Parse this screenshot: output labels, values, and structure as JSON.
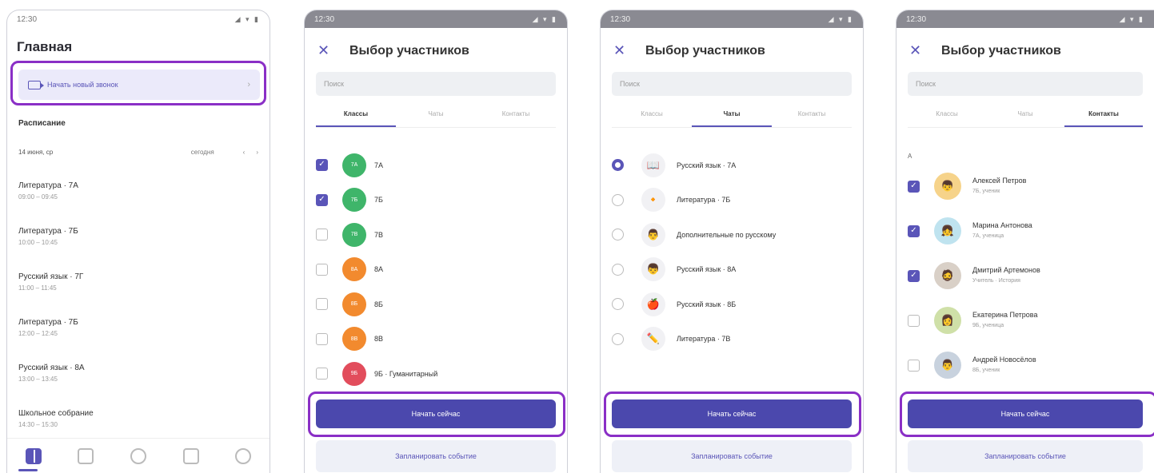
{
  "screen1": {
    "status_time": "12:30",
    "status_icons": "◢ ▾ ▮",
    "title": "Главная",
    "call_button": "Начать новый звонок",
    "schedule_heading": "Расписание",
    "date": "14 июня, ср",
    "today": "сегодня",
    "lessons": [
      {
        "name": "Литература · 7А",
        "time": "09:00 – 09:45"
      },
      {
        "name": "Литература · 7Б",
        "time": "10:00 – 10:45"
      },
      {
        "name": "Русский язык · 7Г",
        "time": "11:00 – 11:45"
      },
      {
        "name": "Литература · 7Б",
        "time": "12:00 – 12:45"
      },
      {
        "name": "Русский язык · 8А",
        "time": "13:00 – 13:45"
      },
      {
        "name": "Школьное собрание",
        "time": "14:30 – 15:30"
      }
    ],
    "tabbar_icons": [
      "home-icon",
      "school-icon",
      "chat-icon",
      "document-icon",
      "profile-icon"
    ]
  },
  "picker": {
    "title": "Выбор участников",
    "close": "✕",
    "search_placeholder": "Поиск",
    "tabs": [
      "Классы",
      "Чаты",
      "Контакты"
    ],
    "primary": "Начать сейчас",
    "secondary": "Запланировать событие"
  },
  "classes": [
    {
      "avatar": "7А",
      "label": "7А",
      "checked": true,
      "color": "#3fb56a"
    },
    {
      "avatar": "7Б",
      "label": "7Б",
      "checked": true,
      "color": "#3fb56a"
    },
    {
      "avatar": "7В",
      "label": "7В",
      "checked": false,
      "color": "#3fb56a"
    },
    {
      "avatar": "8А",
      "label": "8А",
      "checked": false,
      "color": "#f28a2e"
    },
    {
      "avatar": "8Б",
      "label": "8Б",
      "checked": false,
      "color": "#f28a2e"
    },
    {
      "avatar": "8В",
      "label": "8В",
      "checked": false,
      "color": "#f28a2e"
    },
    {
      "avatar": "9Б",
      "label": "9Б · Гуманитарный",
      "checked": false,
      "color": "#e24d5c"
    }
  ],
  "chats": [
    {
      "icon": "📖",
      "label": "Русский язык · 7А",
      "selected": true
    },
    {
      "icon": "🔸",
      "label": "Литература · 7Б",
      "selected": false
    },
    {
      "icon": "👨",
      "label": "Дополнительные по русскому",
      "selected": false
    },
    {
      "icon": "👦",
      "label": "Русский язык · 8А",
      "selected": false
    },
    {
      "icon": "🍎",
      "label": "Русский язык · 8Б",
      "selected": false
    },
    {
      "icon": "✏️",
      "label": "Литература · 7В",
      "selected": false
    }
  ],
  "contacts": {
    "letter": "А",
    "items": [
      {
        "name": "Алексей Петров",
        "sub": "7Б, ученик",
        "checked": true,
        "emoji": "👦",
        "bg": "#f6d38a"
      },
      {
        "name": "Марина Антонова",
        "sub": "7А, ученица",
        "checked": true,
        "emoji": "👧",
        "bg": "#bfe3ef"
      },
      {
        "name": "Дмитрий Артемонов",
        "sub": "Учитель · История",
        "checked": true,
        "emoji": "🧔",
        "bg": "#d9d0c7"
      },
      {
        "name": "Екатерина Петрова",
        "sub": "9Б, ученица",
        "checked": false,
        "emoji": "👩",
        "bg": "#cfe0a8"
      },
      {
        "name": "Андрей Новосёлов",
        "sub": "8Б, ученик",
        "checked": false,
        "emoji": "👨",
        "bg": "#c8d2de"
      }
    ]
  }
}
